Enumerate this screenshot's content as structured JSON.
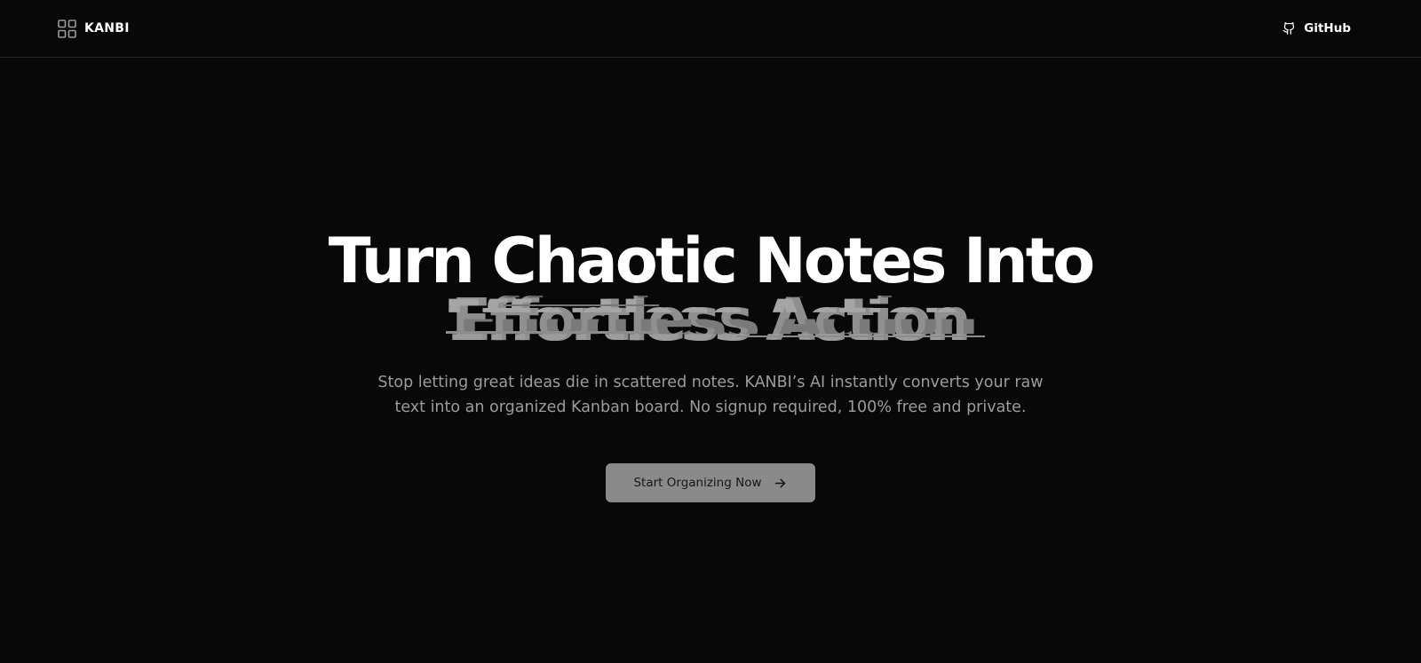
{
  "header": {
    "brand": "KANBI",
    "github_label": "GitHub"
  },
  "hero": {
    "title": "Turn Chaotic Notes Into",
    "highlight": "Effortless Action",
    "subtitle": "Stop letting great ideas die in scattered notes. KANBI’s AI instantly converts your raw text into an organized Kanban board. No signup required, 100% free and private.",
    "cta_label": "Start Organizing Now"
  },
  "icons": {
    "brand": "grid-icon",
    "github": "github-icon",
    "cta": "arrow-right-icon"
  },
  "colors": {
    "background": "#080808",
    "text_primary": "#ffffff",
    "text_muted": "#9c9c9c",
    "highlight": "#8f8f8f",
    "button_bg": "#8a8a8a",
    "button_text": "#161616",
    "divider": "#262626"
  }
}
